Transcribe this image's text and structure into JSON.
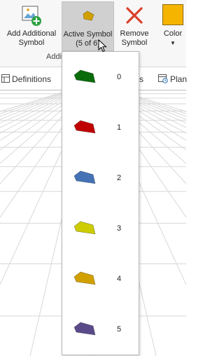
{
  "ribbon": {
    "add_button": {
      "line1": "Add Additional",
      "line2": "Symbol"
    },
    "active_button": {
      "line1": "Active Symbol",
      "line2": "(5 of 6)"
    },
    "remove_button": {
      "line1": "Remove",
      "line2": "Symbol"
    },
    "color_button": {
      "label": "Color",
      "swatch_color": "#f5b400"
    },
    "group_label": "Addi"
  },
  "toolbar": {
    "definitions_label": "Definitions",
    "middle_label": "s",
    "plan_label": "Plan"
  },
  "symbols": [
    {
      "index": "0",
      "color": "#0a6b0a"
    },
    {
      "index": "1",
      "color": "#c00000"
    },
    {
      "index": "2",
      "color": "#4472b5"
    },
    {
      "index": "3",
      "color": "#cccc00"
    },
    {
      "index": "4",
      "color": "#d1a000"
    },
    {
      "index": "5",
      "color": "#5a4a8a"
    }
  ],
  "active_symbol_color": "#d1a000"
}
